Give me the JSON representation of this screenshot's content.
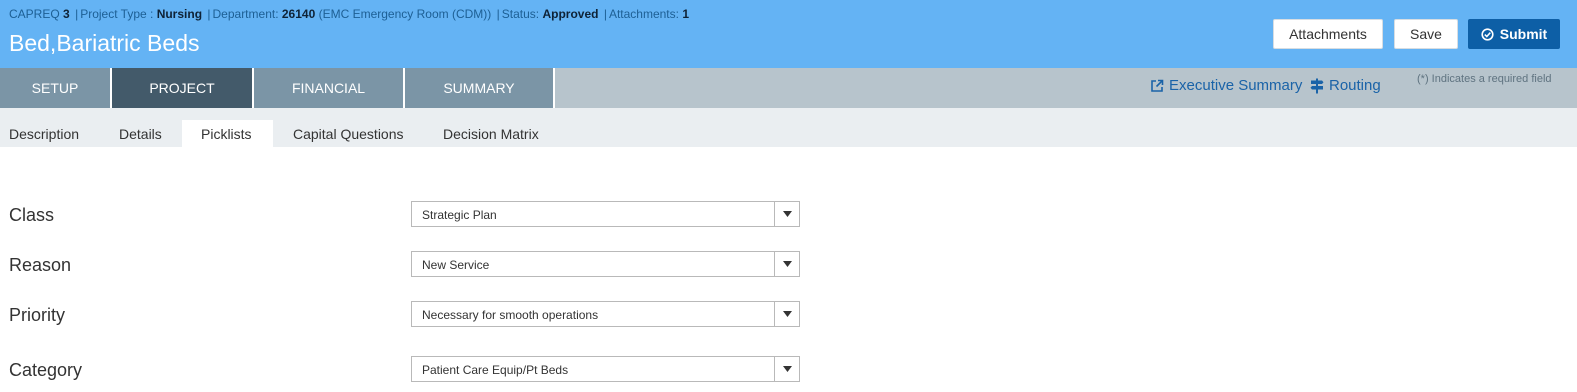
{
  "header": {
    "meta": {
      "capreq_label": "CAPREQ",
      "capreq_value": "3",
      "project_type_label": "Project Type :",
      "project_type_value": "Nursing",
      "department_label": "Department:",
      "department_value": "26140",
      "department_name": "(EMC Emergency Room (CDM))",
      "status_label": "Status:",
      "status_value": "Approved",
      "attachments_label": "Attachments:",
      "attachments_value": "1",
      "separator": "|"
    },
    "title": "Bed,Bariatric Beds",
    "buttons": {
      "attachments": "Attachments",
      "save": "Save",
      "submit": "Submit"
    }
  },
  "main_tabs": [
    {
      "label": "SETUP",
      "active": false
    },
    {
      "label": "PROJECT",
      "active": true
    },
    {
      "label": "FINANCIAL",
      "active": false
    },
    {
      "label": "SUMMARY",
      "active": false
    }
  ],
  "links": {
    "executive_summary": "Executive Summary",
    "routing": "Routing"
  },
  "required_note": "(*) Indicates a required field",
  "sub_tabs": [
    {
      "label": "Description",
      "active": false
    },
    {
      "label": "Details",
      "active": false
    },
    {
      "label": "Picklists",
      "active": true
    },
    {
      "label": "Capital Questions",
      "active": false
    },
    {
      "label": "Decision Matrix",
      "active": false
    }
  ],
  "form": {
    "fields": [
      {
        "label": "Class",
        "value": "Strategic Plan"
      },
      {
        "label": "Reason",
        "value": "New Service"
      },
      {
        "label": "Priority",
        "value": "Necessary for smooth operations"
      },
      {
        "label": "Category",
        "value": "Patient Care Equip/Pt Beds"
      }
    ]
  },
  "colors": {
    "header_bg": "#64b3f4",
    "active_tab_bg": "#435a6a",
    "tab_bg": "#7b95a6",
    "submit_bg": "#0d5fa6",
    "link_color": "#1a63a8"
  },
  "icons": {
    "submit": "check-circle-icon",
    "executive_summary": "external-link-icon",
    "routing": "signpost-icon",
    "dropdown": "caret-down-icon"
  }
}
